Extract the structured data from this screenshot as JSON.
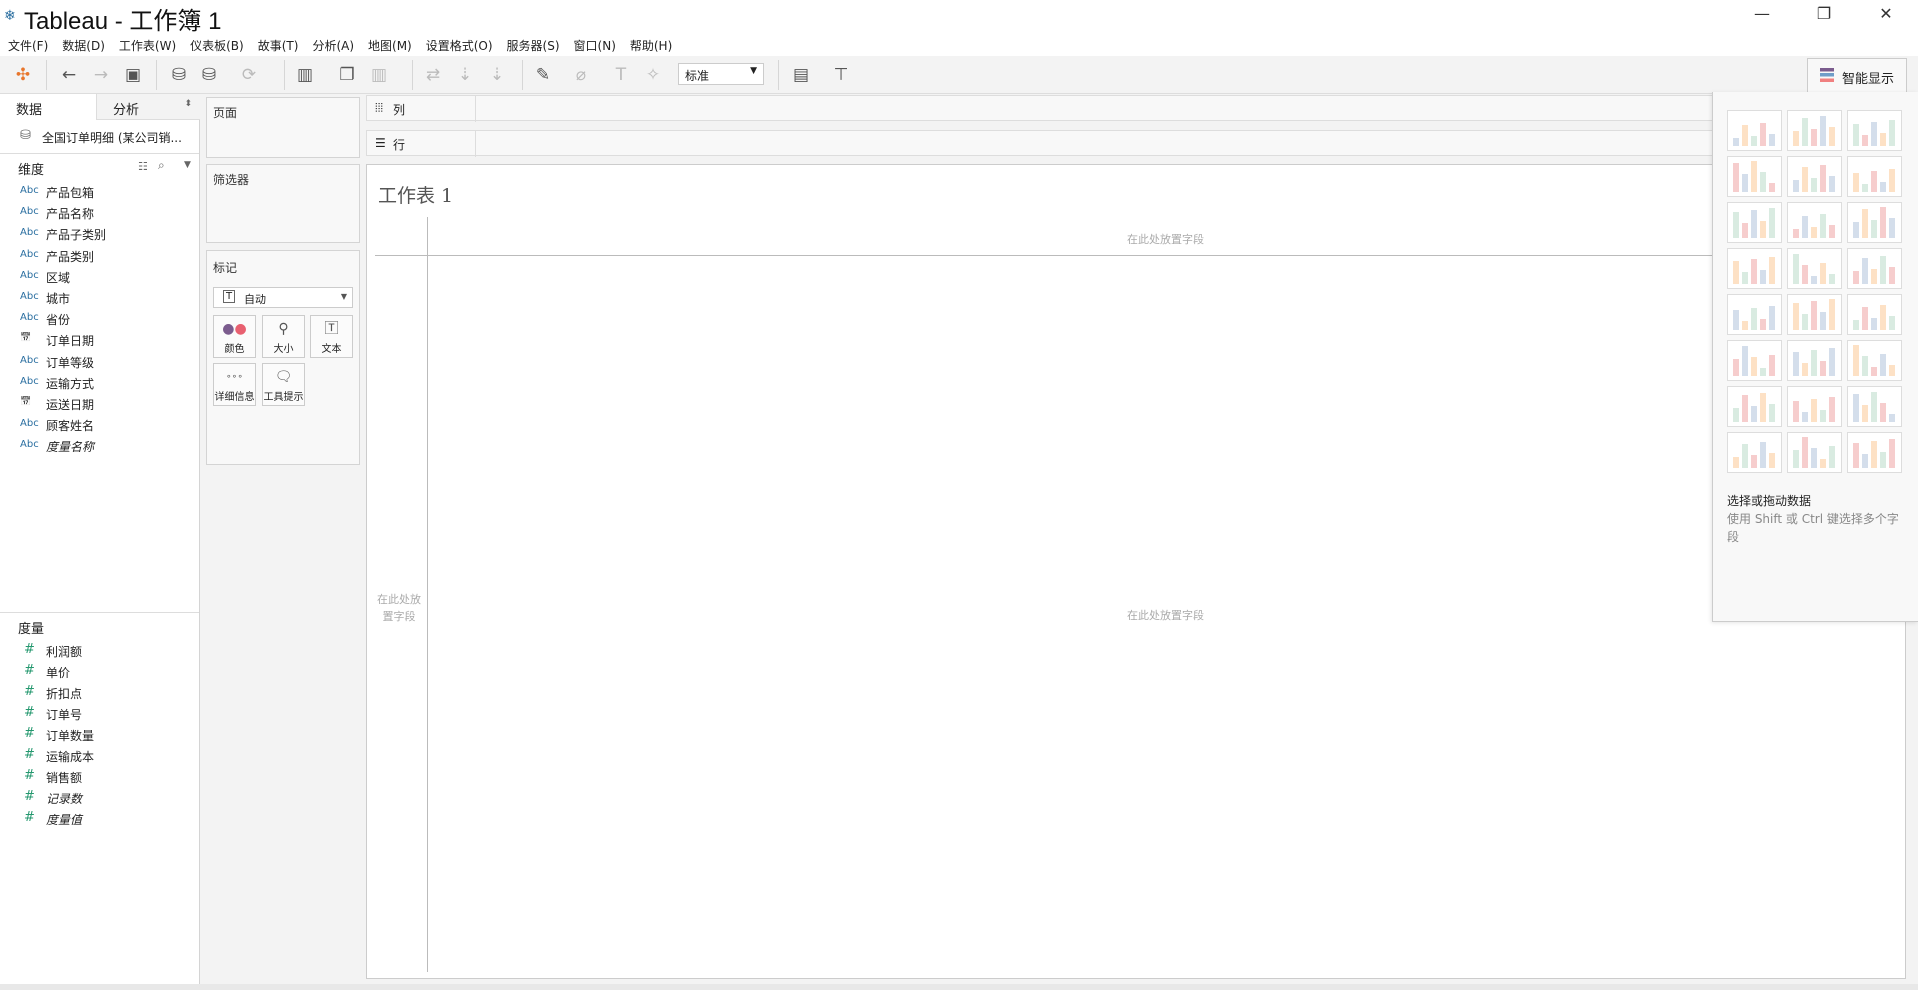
{
  "window": {
    "title": "Tableau - 工作簿 1",
    "minimize": "—",
    "restore": "❐",
    "close": "✕"
  },
  "menu": [
    "文件(F)",
    "数据(D)",
    "工作表(W)",
    "仪表板(B)",
    "故事(T)",
    "分析(A)",
    "地图(M)",
    "设置格式(O)",
    "服务器(S)",
    "窗口(N)",
    "帮助(H)"
  ],
  "toolbar": {
    "fit_select": "标准",
    "smart_show_tab": "智能显示"
  },
  "left_panel": {
    "tabs": [
      "数据",
      "分析"
    ],
    "datasource": "全国订单明细 (某公司销...",
    "dimensions_header": "维度",
    "dimensions": [
      {
        "icon": "abc",
        "label": "产品包箱"
      },
      {
        "icon": "abc",
        "label": "产品名称"
      },
      {
        "icon": "abc",
        "label": "产品子类别"
      },
      {
        "icon": "abc",
        "label": "产品类别"
      },
      {
        "icon": "abc",
        "label": "区域"
      },
      {
        "icon": "abc",
        "label": "城市"
      },
      {
        "icon": "abc",
        "label": "省份"
      },
      {
        "icon": "date",
        "label": "订单日期"
      },
      {
        "icon": "abc",
        "label": "订单等级"
      },
      {
        "icon": "abc",
        "label": "运输方式"
      },
      {
        "icon": "date",
        "label": "运送日期"
      },
      {
        "icon": "abc",
        "label": "顾客姓名"
      },
      {
        "icon": "abc",
        "label": "度量名称",
        "italic": true
      }
    ],
    "measures_header": "度量",
    "measures": [
      {
        "label": "利润额"
      },
      {
        "label": "单价"
      },
      {
        "label": "折扣点"
      },
      {
        "label": "订单号"
      },
      {
        "label": "订单数量"
      },
      {
        "label": "运输成本"
      },
      {
        "label": "销售额"
      },
      {
        "label": "记录数",
        "italic": true
      },
      {
        "label": "度量值",
        "italic": true
      }
    ]
  },
  "cards": {
    "pages": "页面",
    "filters": "筛选器",
    "marks": "标记",
    "mark_type": "自动",
    "mark_buttons": [
      "颜色",
      "大小",
      "文本",
      "详细信息",
      "工具提示"
    ]
  },
  "shelves": {
    "columns": "列",
    "rows": "行"
  },
  "sheet": {
    "title": "工作表 1",
    "drop_top": "在此处放置字段",
    "drop_center": "在此处放置字段",
    "drop_left": "在此处放置字段"
  },
  "smart_show": {
    "heading": "选择或拖动数据",
    "hint": "使用 Shift 或 Ctrl 键选择多个字段"
  },
  "colors": {
    "accent": "#2a6ea0",
    "measure": "#25986f"
  }
}
